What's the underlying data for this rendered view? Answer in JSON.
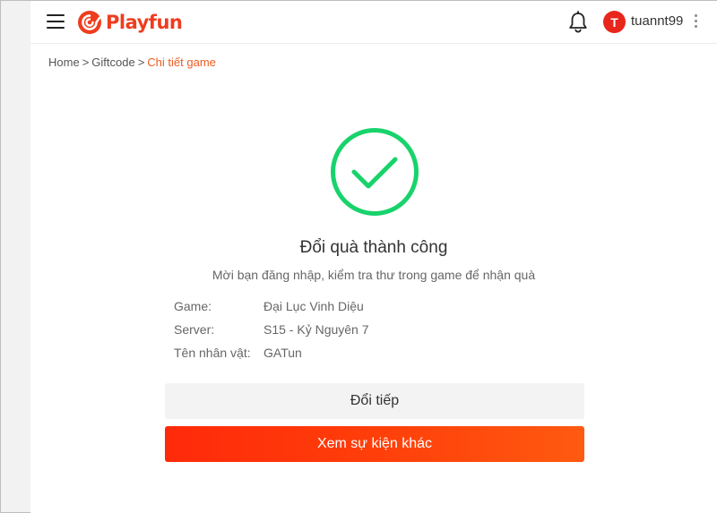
{
  "header": {
    "logo_text": "Playfun",
    "brand_color": "#ee3d1e",
    "menu_icon": "hamburger-icon",
    "notification_icon": "bell-icon",
    "avatar_initial": "T",
    "avatar_color": "#e8261c",
    "username": "tuannt99",
    "more_icon": "kebab-menu-icon"
  },
  "breadcrumb": {
    "items": [
      "Home",
      "Giftcode"
    ],
    "current": "Chi tiết game",
    "separator": ">",
    "current_color": "#ec5b22"
  },
  "result": {
    "icon": "check-circle-icon",
    "icon_color": "#18d36b",
    "title": "Đổi quà thành công",
    "subtitle": "Mời bạn đăng nhập, kiểm tra thư trong game để nhận quà"
  },
  "details": [
    {
      "label": "Game:",
      "value": "Đại Lục Vinh Diệu"
    },
    {
      "label": "Server:",
      "value": "S15 - Kỷ Nguyên 7"
    },
    {
      "label": "Tên nhân vật:",
      "value": "GATun"
    }
  ],
  "actions": {
    "continue_label": "Đổi tiếp",
    "events_label": "Xem sự kiện khác",
    "primary_color": "#ff3e0a"
  }
}
